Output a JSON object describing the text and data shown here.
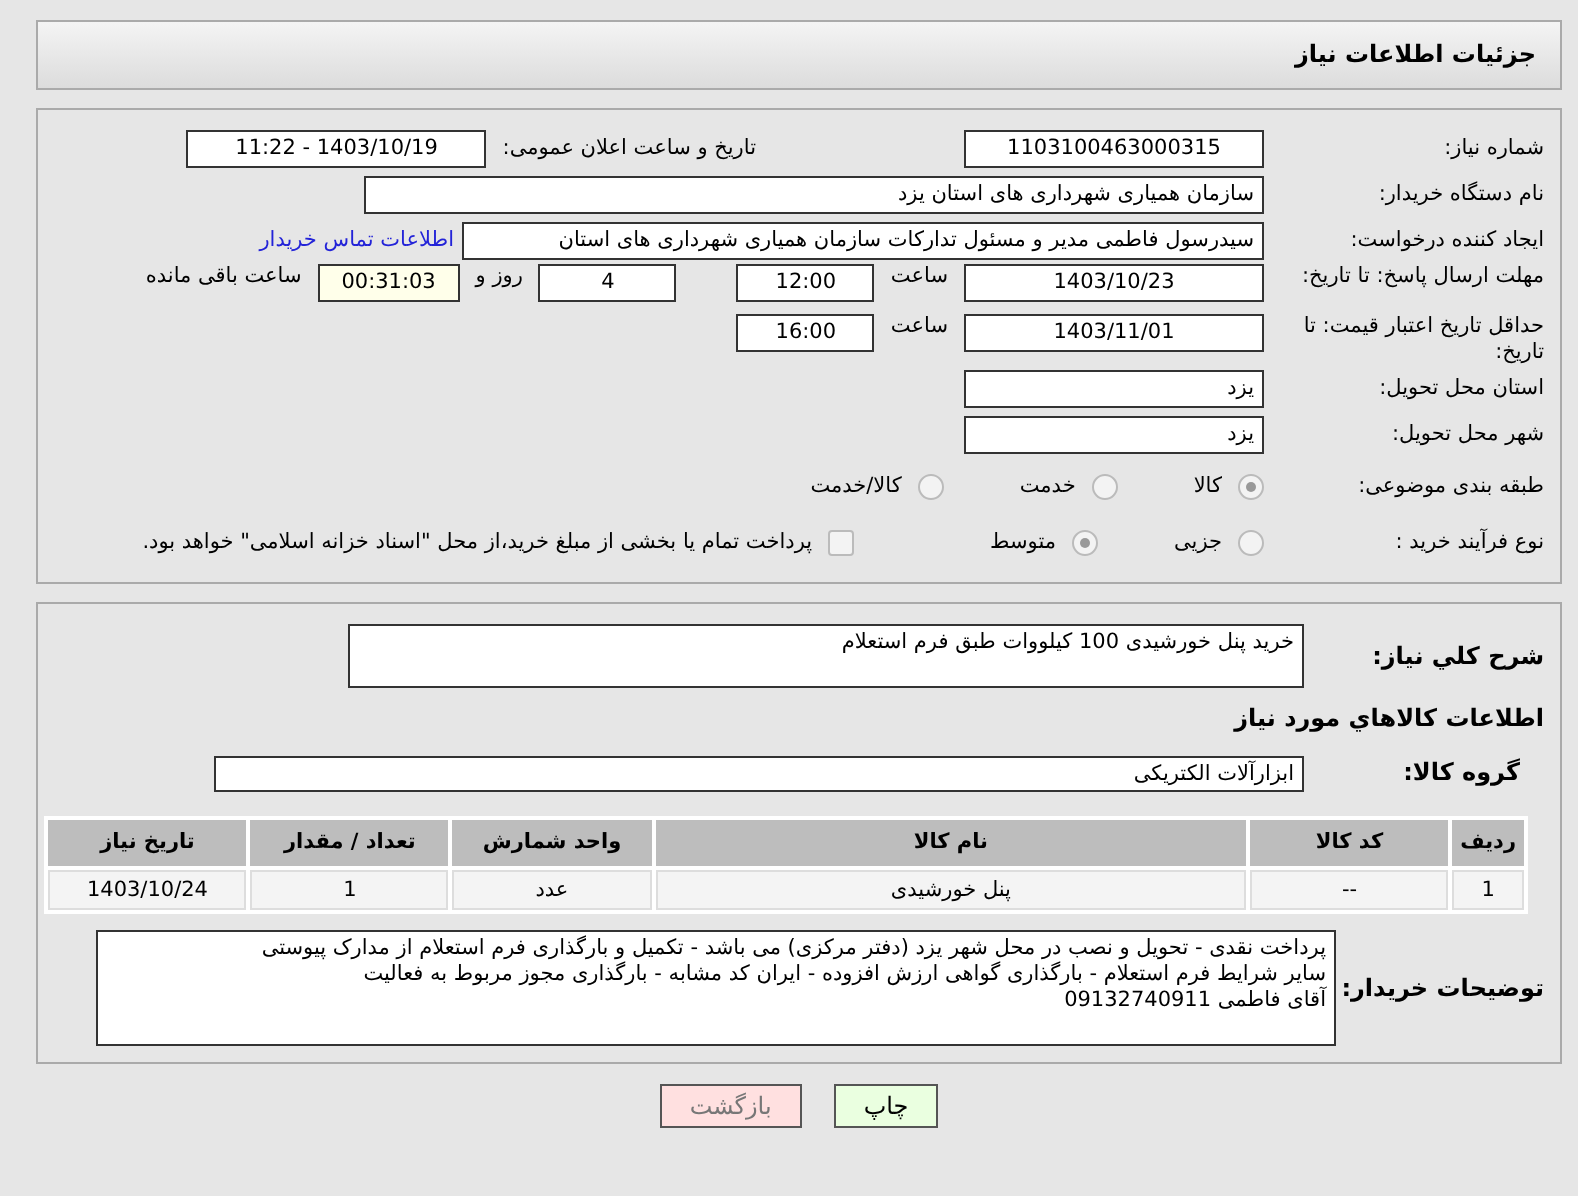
{
  "header": {
    "title": "جزئیات اطلاعات نیاز"
  },
  "need_number": {
    "label": "شماره نیاز:",
    "value": "1103100463000315"
  },
  "announce": {
    "label": "تاریخ و ساعت اعلان عمومی:",
    "value": "1403/10/19 - 11:22"
  },
  "buyer": {
    "label": "نام دستگاه خریدار:",
    "value": "سازمان همیاری شهرداری های استان یزد"
  },
  "requester": {
    "label": "ایجاد کننده درخواست:",
    "value": "سیدرسول فاطمی مدیر و مسئول تدارکات سازمان همیاری شهرداری های استان",
    "link": "اطلاعات تماس خریدار"
  },
  "deadline": {
    "label": "مهلت ارسال پاسخ: تا تاریخ:",
    "date": "1403/10/23",
    "time_label": "ساعت",
    "time": "12:00",
    "days": "4",
    "days_label": "روز و",
    "remaining": "00:31:03",
    "remaining_label": "ساعت باقی مانده"
  },
  "validity": {
    "label": "حداقل تاریخ اعتبار قیمت: تا تاریخ:",
    "date": "1403/11/01",
    "time_label": "ساعت",
    "time": "16:00"
  },
  "province": {
    "label": "استان محل تحویل:",
    "value": "یزد"
  },
  "city": {
    "label": "شهر محل تحویل:",
    "value": "یزد"
  },
  "category": {
    "label": "طبقه بندی موضوعی:",
    "options": [
      {
        "label": "کالا",
        "selected": true
      },
      {
        "label": "خدمت",
        "selected": false
      },
      {
        "label": "کالا/خدمت",
        "selected": false
      }
    ]
  },
  "process": {
    "label": "نوع فرآیند خرید :",
    "options": [
      {
        "label": "جزیی",
        "selected": false
      },
      {
        "label": "متوسط",
        "selected": true
      }
    ],
    "note": {
      "checked": false,
      "text": "پرداخت تمام یا بخشی از مبلغ خرید،از محل \"اسناد خزانه اسلامی\" خواهد بود."
    }
  },
  "description": {
    "label": "شرح کلي نياز:",
    "value": "خرید پنل خورشیدی 100 کیلووات طبق فرم استعلام"
  },
  "goods_title": "اطلاعات کالاهاي مورد نياز",
  "group": {
    "label": "گروه کالا:",
    "value": "ابزارآلات الکتریکی"
  },
  "table": {
    "columns": [
      "ردیف",
      "کد کالا",
      "نام کالا",
      "واحد شمارش",
      "تعداد / مقدار",
      "تاریخ نیاز"
    ],
    "rows": [
      [
        "1",
        "--",
        "پنل خورشیدی",
        "عدد",
        "1",
        "1403/10/24"
      ]
    ]
  },
  "buyer_notes": {
    "label": "توضیحات خریدار:",
    "lines": [
      "پرداخت نقدی - تحویل و نصب در محل شهر یزد (دفتر مرکزی) می باشد - تکمیل و بارگذاری فرم استعلام از مدارک پیوستی",
      "سایر شرایط فرم استعلام - بارگذاری گواهی ارزش افزوده - ایران کد مشابه - بارگذاری مجوز مربوط به فعالیت",
      "آقای فاطمی 09132740911"
    ]
  },
  "buttons": [
    {
      "label": "چاپ",
      "kind": "print"
    },
    {
      "label": "بازگشت",
      "kind": "back"
    }
  ]
}
